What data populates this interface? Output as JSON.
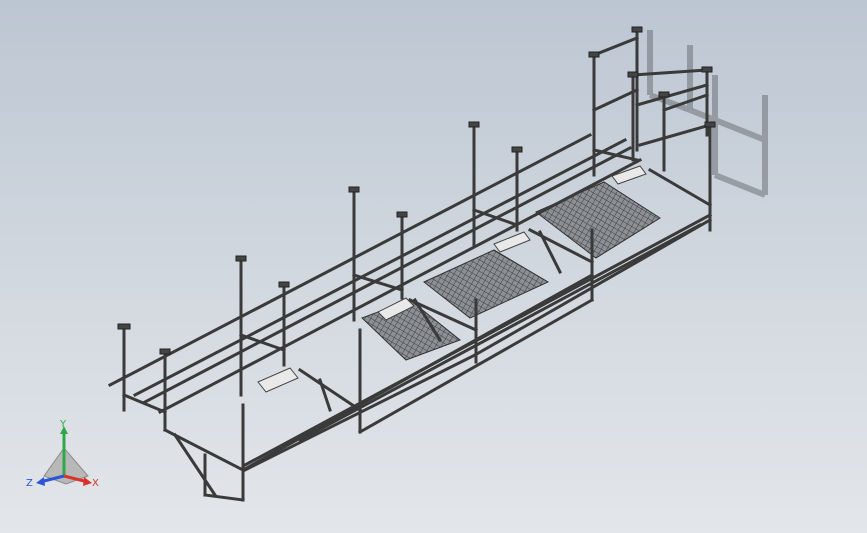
{
  "view": {
    "background_top": "#bcc6d2",
    "background_bottom": "#e3e6ea",
    "model_color": "#3a3a3a",
    "mesh_color": "#555555"
  },
  "triad": {
    "x_label": "X",
    "y_label": "Y",
    "z_label": "Z",
    "x_color": "#d8332a",
    "y_color": "#2fa84a",
    "z_color": "#2b55d6"
  }
}
